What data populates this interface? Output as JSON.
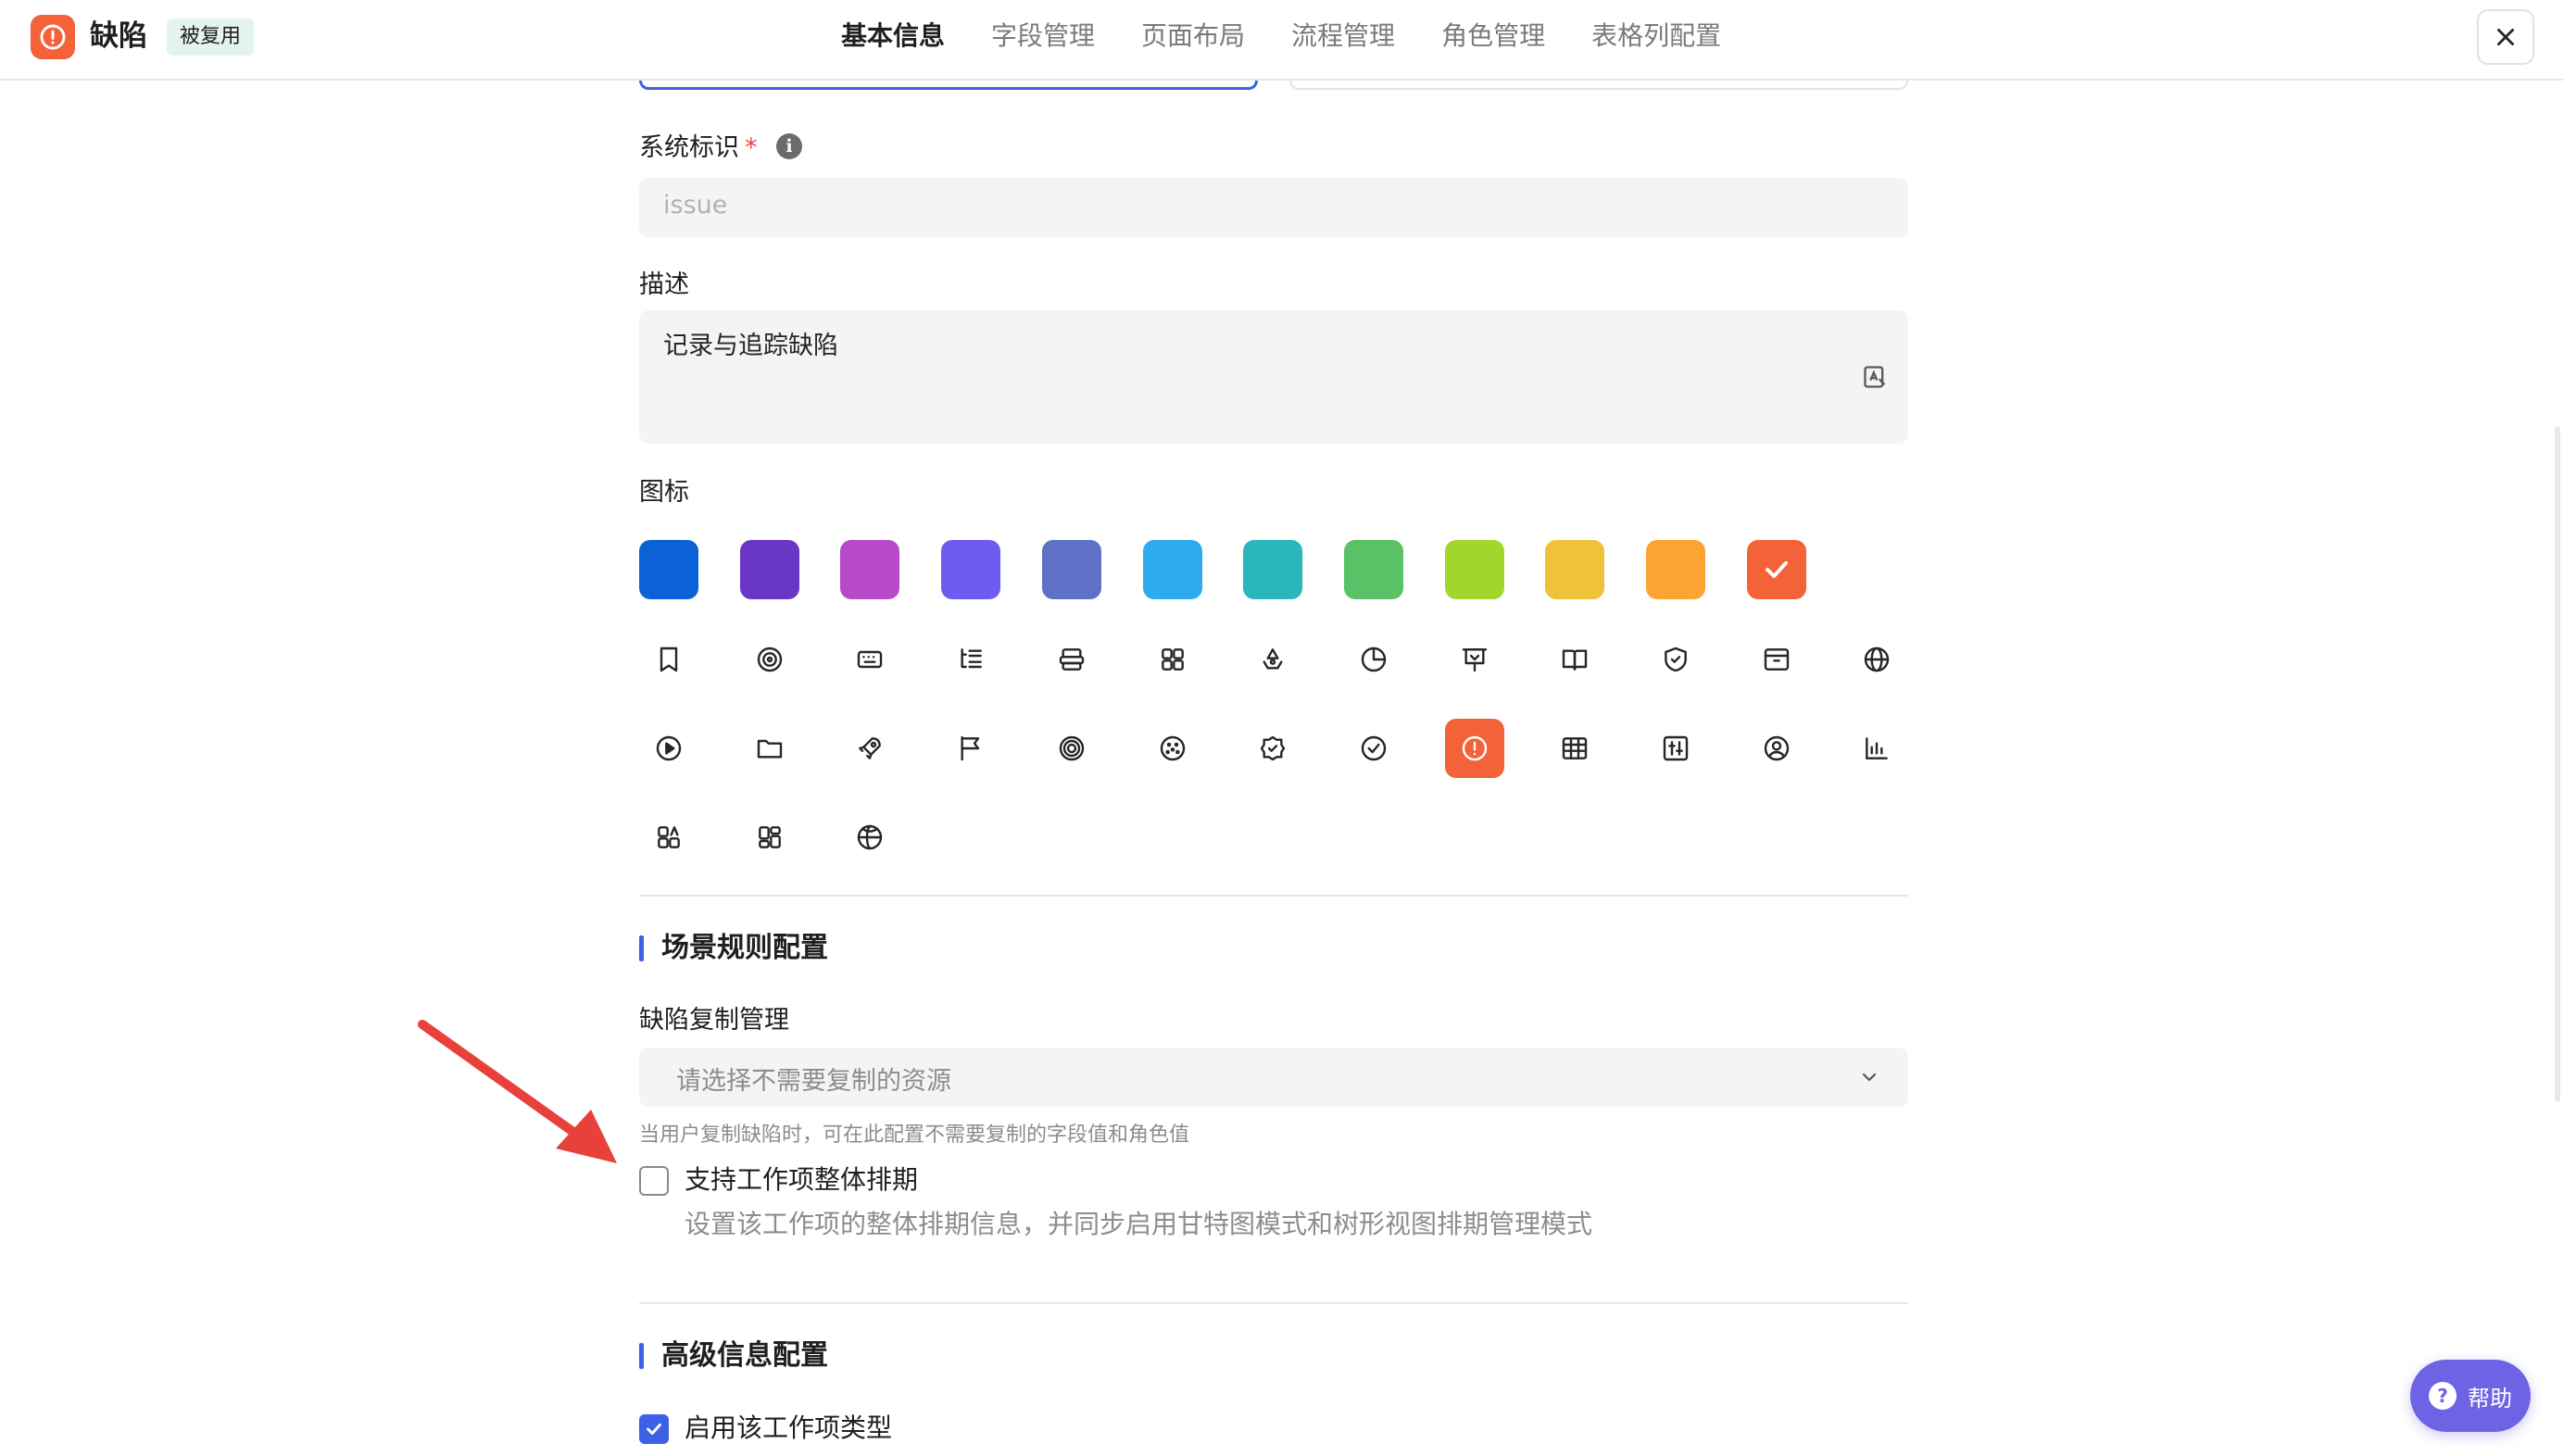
{
  "header": {
    "title": "缺陷",
    "badge": "被复用",
    "tabs": [
      {
        "label": "基本信息",
        "active": true
      },
      {
        "label": "字段管理",
        "active": false
      },
      {
        "label": "页面布局",
        "active": false
      },
      {
        "label": "流程管理",
        "active": false
      },
      {
        "label": "角色管理",
        "active": false
      },
      {
        "label": "表格列配置",
        "active": false
      }
    ]
  },
  "form": {
    "system_id": {
      "label": "系统标识",
      "required_mark": "*",
      "placeholder": "issue"
    },
    "description": {
      "label": "描述",
      "value": "记录与追踪缺陷"
    },
    "icon": {
      "label": "图标",
      "colors": [
        "#0a62d6",
        "#6936c6",
        "#b74ac9",
        "#6e5cf2",
        "#5e71c7",
        "#2eabef",
        "#2bb5bd",
        "#5ac166",
        "#a3d62c",
        "#efc23c",
        "#fba433",
        "#f4623a"
      ],
      "selected_color_index": 11,
      "icons": [
        "bookmark-icon",
        "spiral-icon",
        "keyboard-icon",
        "list-tree-icon",
        "layers-icon",
        "grid-icon",
        "recycle-icon",
        "pie-icon",
        "presentation-icon",
        "book-icon",
        "shield-check-icon",
        "archive-icon",
        "globe-icon",
        "play-circle-icon",
        "folder-icon",
        "rocket-icon",
        "flag-icon",
        "target-icon",
        "dotted-circle-icon",
        "badge-check-icon",
        "check-circle-icon",
        "alert-circle-icon",
        "table-icon",
        "sliders-icon",
        "user-circle-icon",
        "bar-chart-icon",
        "app-grid-icon",
        "dashboard-icon",
        "basketball-icon"
      ],
      "selected_icon": "alert-circle-icon"
    }
  },
  "scenario": {
    "title": "场景规则配置",
    "copy_manage": {
      "label": "缺陷复制管理",
      "placeholder": "请选择不需要复制的资源",
      "hint": "当用户复制缺陷时，可在此配置不需要复制的字段值和角色值"
    },
    "schedule": {
      "label": "支持工作项整体排期",
      "description": "设置该工作项的整体排期信息，并同步启用甘特图模式和树形视图排期管理模式",
      "checked": false
    }
  },
  "advanced": {
    "title": "高级信息配置",
    "enable": {
      "label": "启用该工作项类型",
      "checked": true
    }
  },
  "help": {
    "label": "帮助"
  },
  "colors": {
    "accent": "#3c60e6",
    "brand": "#f4623a",
    "help": "#6e63e5",
    "annotation_arrow": "#e8403a"
  }
}
